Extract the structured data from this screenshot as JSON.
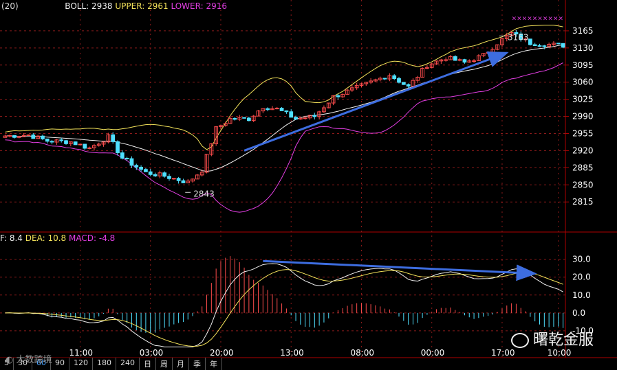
{
  "header": {
    "period_label": "(20)",
    "boll_label": "BOLL:",
    "boll_value": "2938",
    "upper_label": "UPPER:",
    "upper_value": "2961",
    "lower_label": "LOWER:",
    "lower_value": "2916"
  },
  "macd_header": {
    "dif_label": "F:",
    "dif_value": "8.4",
    "dea_label": "DEA:",
    "dea_value": "10.8",
    "macd_label": "MACD:",
    "macd_value": "-4.8"
  },
  "colors": {
    "up": "#ff4d4d",
    "down": "#4fe0ff",
    "boll_mid": "#f0f0f0",
    "upper": "#f3e25a",
    "lower": "#e23ee2",
    "trend": "#3d6de0",
    "grid": "#8a1a1a",
    "axis_text": "#ffffff"
  },
  "chart_data": [
    {
      "type": "candlestick",
      "title": "",
      "y_ticks": [
        3165,
        3130,
        3095,
        3060,
        3025,
        2990,
        2955,
        2920,
        2885,
        2850,
        2815
      ],
      "ylim": [
        2790,
        3200
      ],
      "x_ticks": [
        "11:00",
        "03:00",
        "20:00",
        "13:00",
        "08:00",
        "00:00",
        "17:00",
        "10:00"
      ],
      "annotations": [
        {
          "text": "2843",
          "x_index": 39,
          "y": 2843
        },
        {
          "text": "3163",
          "x_index": 106,
          "y": 3163
        }
      ],
      "markers_label": "××××××××××",
      "trend_line": {
        "start": {
          "x_index": 51,
          "y": 2920
        },
        "end": {
          "x_index": 107,
          "y": 3120
        }
      },
      "series": [
        {
          "name": "BOLL",
          "color": "#f0f0f0"
        },
        {
          "name": "UPPER",
          "color": "#f3e25a"
        },
        {
          "name": "LOWER",
          "color": "#e23ee2"
        }
      ]
    },
    {
      "type": "macd",
      "title": "",
      "y_ticks": [
        30.0,
        20.0,
        10.0,
        0.0,
        -10.0
      ],
      "ylim": [
        -20,
        36
      ],
      "series": [
        {
          "name": "DEA",
          "color": "#f3e25a"
        },
        {
          "name": "MACD",
          "color": "#e23ee2"
        }
      ],
      "trend_line": {
        "start": {
          "x_index": 55,
          "y": 29
        },
        "end": {
          "x_index": 113,
          "y": 22
        }
      }
    }
  ],
  "tabs": [
    "5",
    "30",
    "60",
    "90",
    "120",
    "180",
    "240",
    "日",
    "周",
    "月",
    "季",
    "年"
  ],
  "active_tab": "60",
  "brand_text": "大数跨境",
  "brand_icon": "logo-icon",
  "watermark": "曙乾金服",
  "watermark_icon": "wechat-icon"
}
